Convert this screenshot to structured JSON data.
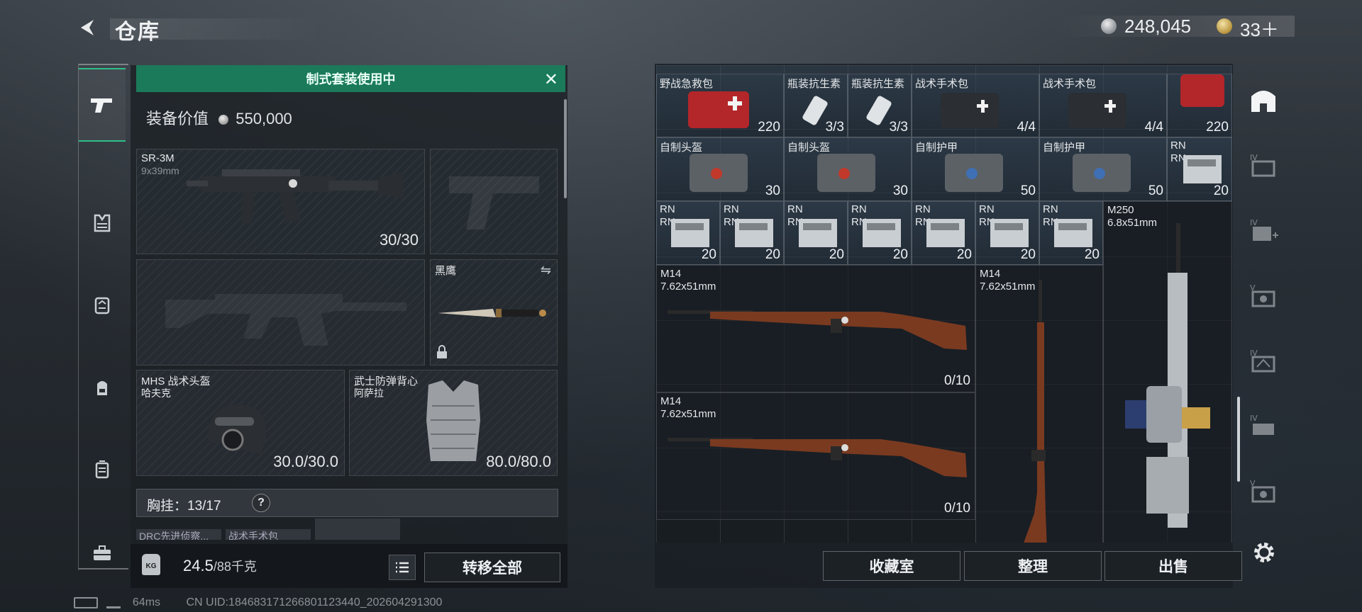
{
  "header": {
    "title": "仓库",
    "silver": "248,045",
    "gold": "33＋"
  },
  "sidebar_left": {
    "icons": [
      "pistol-icon",
      "vest-icon",
      "chest-rig-icon",
      "backpack-icon",
      "case-icon",
      "toolbox-icon"
    ]
  },
  "loadout": {
    "banner": "制式套装使用中",
    "value_label": "装备价值",
    "value": "550,000",
    "primary": {
      "name": "SR-3M",
      "caliber": "9x39mm",
      "ammo": "30/30"
    },
    "knife": {
      "name": "黑鹰"
    },
    "helmet": {
      "name": "MHS 战术头盔",
      "sub": "哈夫克",
      "durability": "30.0/30.0"
    },
    "armor": {
      "name": "武士防弹背心",
      "sub": "阿萨拉",
      "durability": "80.0/80.0"
    },
    "rig": {
      "label": "胸挂：",
      "count": "13/17",
      "help": "?"
    },
    "rig_items": [
      "DRC先进侦察...",
      "战术手术包",
      ""
    ],
    "weight": "24.5",
    "weight_max": "/88千克",
    "transfer_all": "转移全部"
  },
  "status": {
    "ping": "64ms",
    "uid": "CN UID:184683171266801123440_202604291300"
  },
  "storage": {
    "row1": [
      {
        "name": "野战急救包",
        "qty": "220"
      },
      {
        "name": "瓶装抗生素",
        "qty": "3/3"
      },
      {
        "name": "瓶装抗生素",
        "qty": "3/3"
      },
      {
        "name": "战术手术包",
        "qty": "4/4"
      },
      {
        "name": "战术手术包",
        "qty": "4/4"
      },
      {
        "name": "",
        "qty": "220"
      }
    ],
    "row2": [
      {
        "name": "自制头盔",
        "qty": "30"
      },
      {
        "name": "自制头盔",
        "qty": "30"
      },
      {
        "name": "自制护甲",
        "qty": "50"
      },
      {
        "name": "自制护甲",
        "qty": "50"
      },
      {
        "name": "RN",
        "sub": "RN",
        "qty": "20"
      }
    ],
    "row3": [
      {
        "name": "RN",
        "sub": "RN",
        "qty": "20"
      },
      {
        "name": "RN",
        "sub": "RN",
        "qty": "20"
      },
      {
        "name": "RN",
        "sub": "RN",
        "qty": "20"
      },
      {
        "name": "RN",
        "sub": "RN",
        "qty": "20"
      },
      {
        "name": "RN",
        "sub": "RN",
        "qty": "20"
      },
      {
        "name": "RN",
        "sub": "RN",
        "qty": "20"
      },
      {
        "name": "RN",
        "sub": "RN",
        "qty": "20"
      }
    ],
    "m14a": {
      "name": "M14",
      "caliber": "7.62x51mm",
      "ammo": "0/10"
    },
    "m14b": {
      "name": "M14",
      "caliber": "7.62x51mm",
      "ammo": "0/10"
    },
    "m14c": {
      "name": "M14",
      "caliber": "7.62x51mm"
    },
    "m250": {
      "name": "M250",
      "caliber": "6.8x51mm"
    },
    "buttons": {
      "vault": "收藏室",
      "sort": "整理",
      "sell": "出售"
    }
  },
  "sidebar_right": {
    "icons": [
      "safe-house-icon",
      "storage-iv-icon",
      "storage-iv-add-icon",
      "storage-v-icon",
      "storage-iv-b-icon",
      "storage-iv-c-icon",
      "storage-v-b-icon",
      "settings-icon"
    ]
  }
}
